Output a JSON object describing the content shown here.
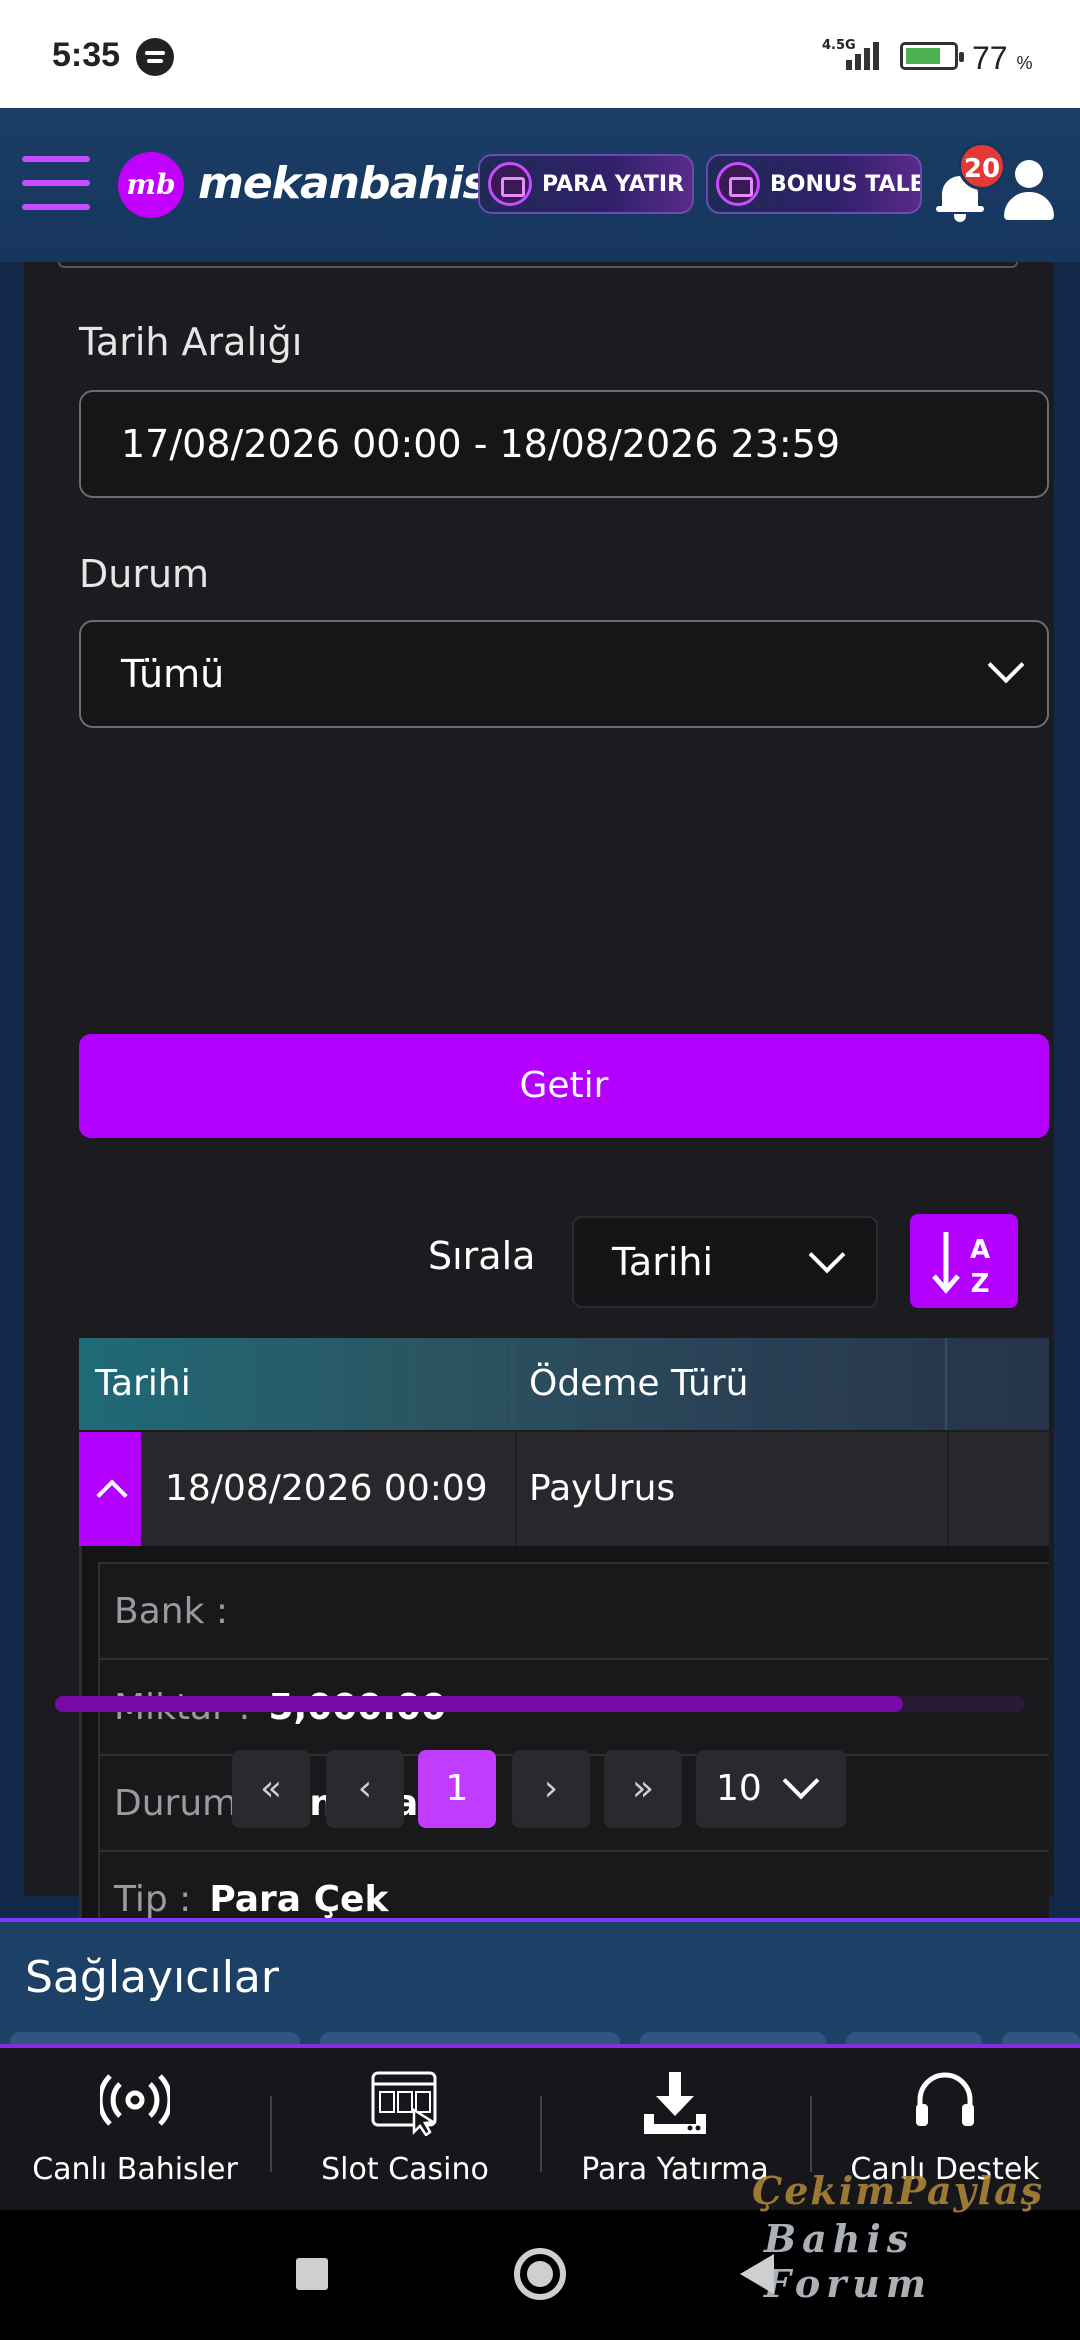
{
  "status_bar": {
    "time": "5:35",
    "network": "4.5G",
    "battery": "77",
    "battery_unit": "%"
  },
  "header": {
    "logo_badge": "mb",
    "logo_text": "mekanbahis",
    "deposit_button": "PARA YATIR",
    "bonus_button": "BONUS TALEP",
    "notification_count": "20"
  },
  "filters": {
    "date_range_label": "Tarih Aralığı",
    "date_range_value": "17/08/2026 00:00 - 18/08/2026 23:59",
    "status_label": "Durum",
    "status_value": "Tümü",
    "submit_label": "Getir"
  },
  "sort": {
    "label": "Sırala",
    "value": "Tarihi",
    "order_icon_text": "A Z"
  },
  "table": {
    "columns": [
      "Tarihi",
      "Ödeme Türü"
    ],
    "rows": [
      {
        "date": "18/08/2026 00:09",
        "payment_type": "PayUrus",
        "details": [
          {
            "key": "Bank :",
            "value": ""
          },
          {
            "key": "Miktar :",
            "value": "5,000.00"
          },
          {
            "key": "Durum :",
            "value": "Onaylanan"
          },
          {
            "key": "Tip :",
            "value": "Para Çek"
          }
        ]
      }
    ],
    "scroll_fraction": 0.874
  },
  "pagination": {
    "first": "«",
    "prev": "‹",
    "current": "1",
    "next": "›",
    "last": "»",
    "page_size": "10"
  },
  "providers": {
    "title": "Sağlayıcılar"
  },
  "bottom_nav": [
    {
      "label": "Canlı Bahisler",
      "icon": "broadcast-icon"
    },
    {
      "label": "Slot Casino",
      "icon": "slot-machine-icon"
    },
    {
      "label": "Para Yatırma",
      "icon": "download-icon"
    },
    {
      "label": "Canlı Destek",
      "icon": "headset-icon"
    }
  ],
  "watermark": {
    "line1": "ÇekimPaylaş",
    "line2": "Bahis Forum"
  },
  "colors": {
    "accent": "#b400ff",
    "header_bg": "#1a3d66",
    "panel_bg": "#1c1c20",
    "badge": "#e53935"
  }
}
